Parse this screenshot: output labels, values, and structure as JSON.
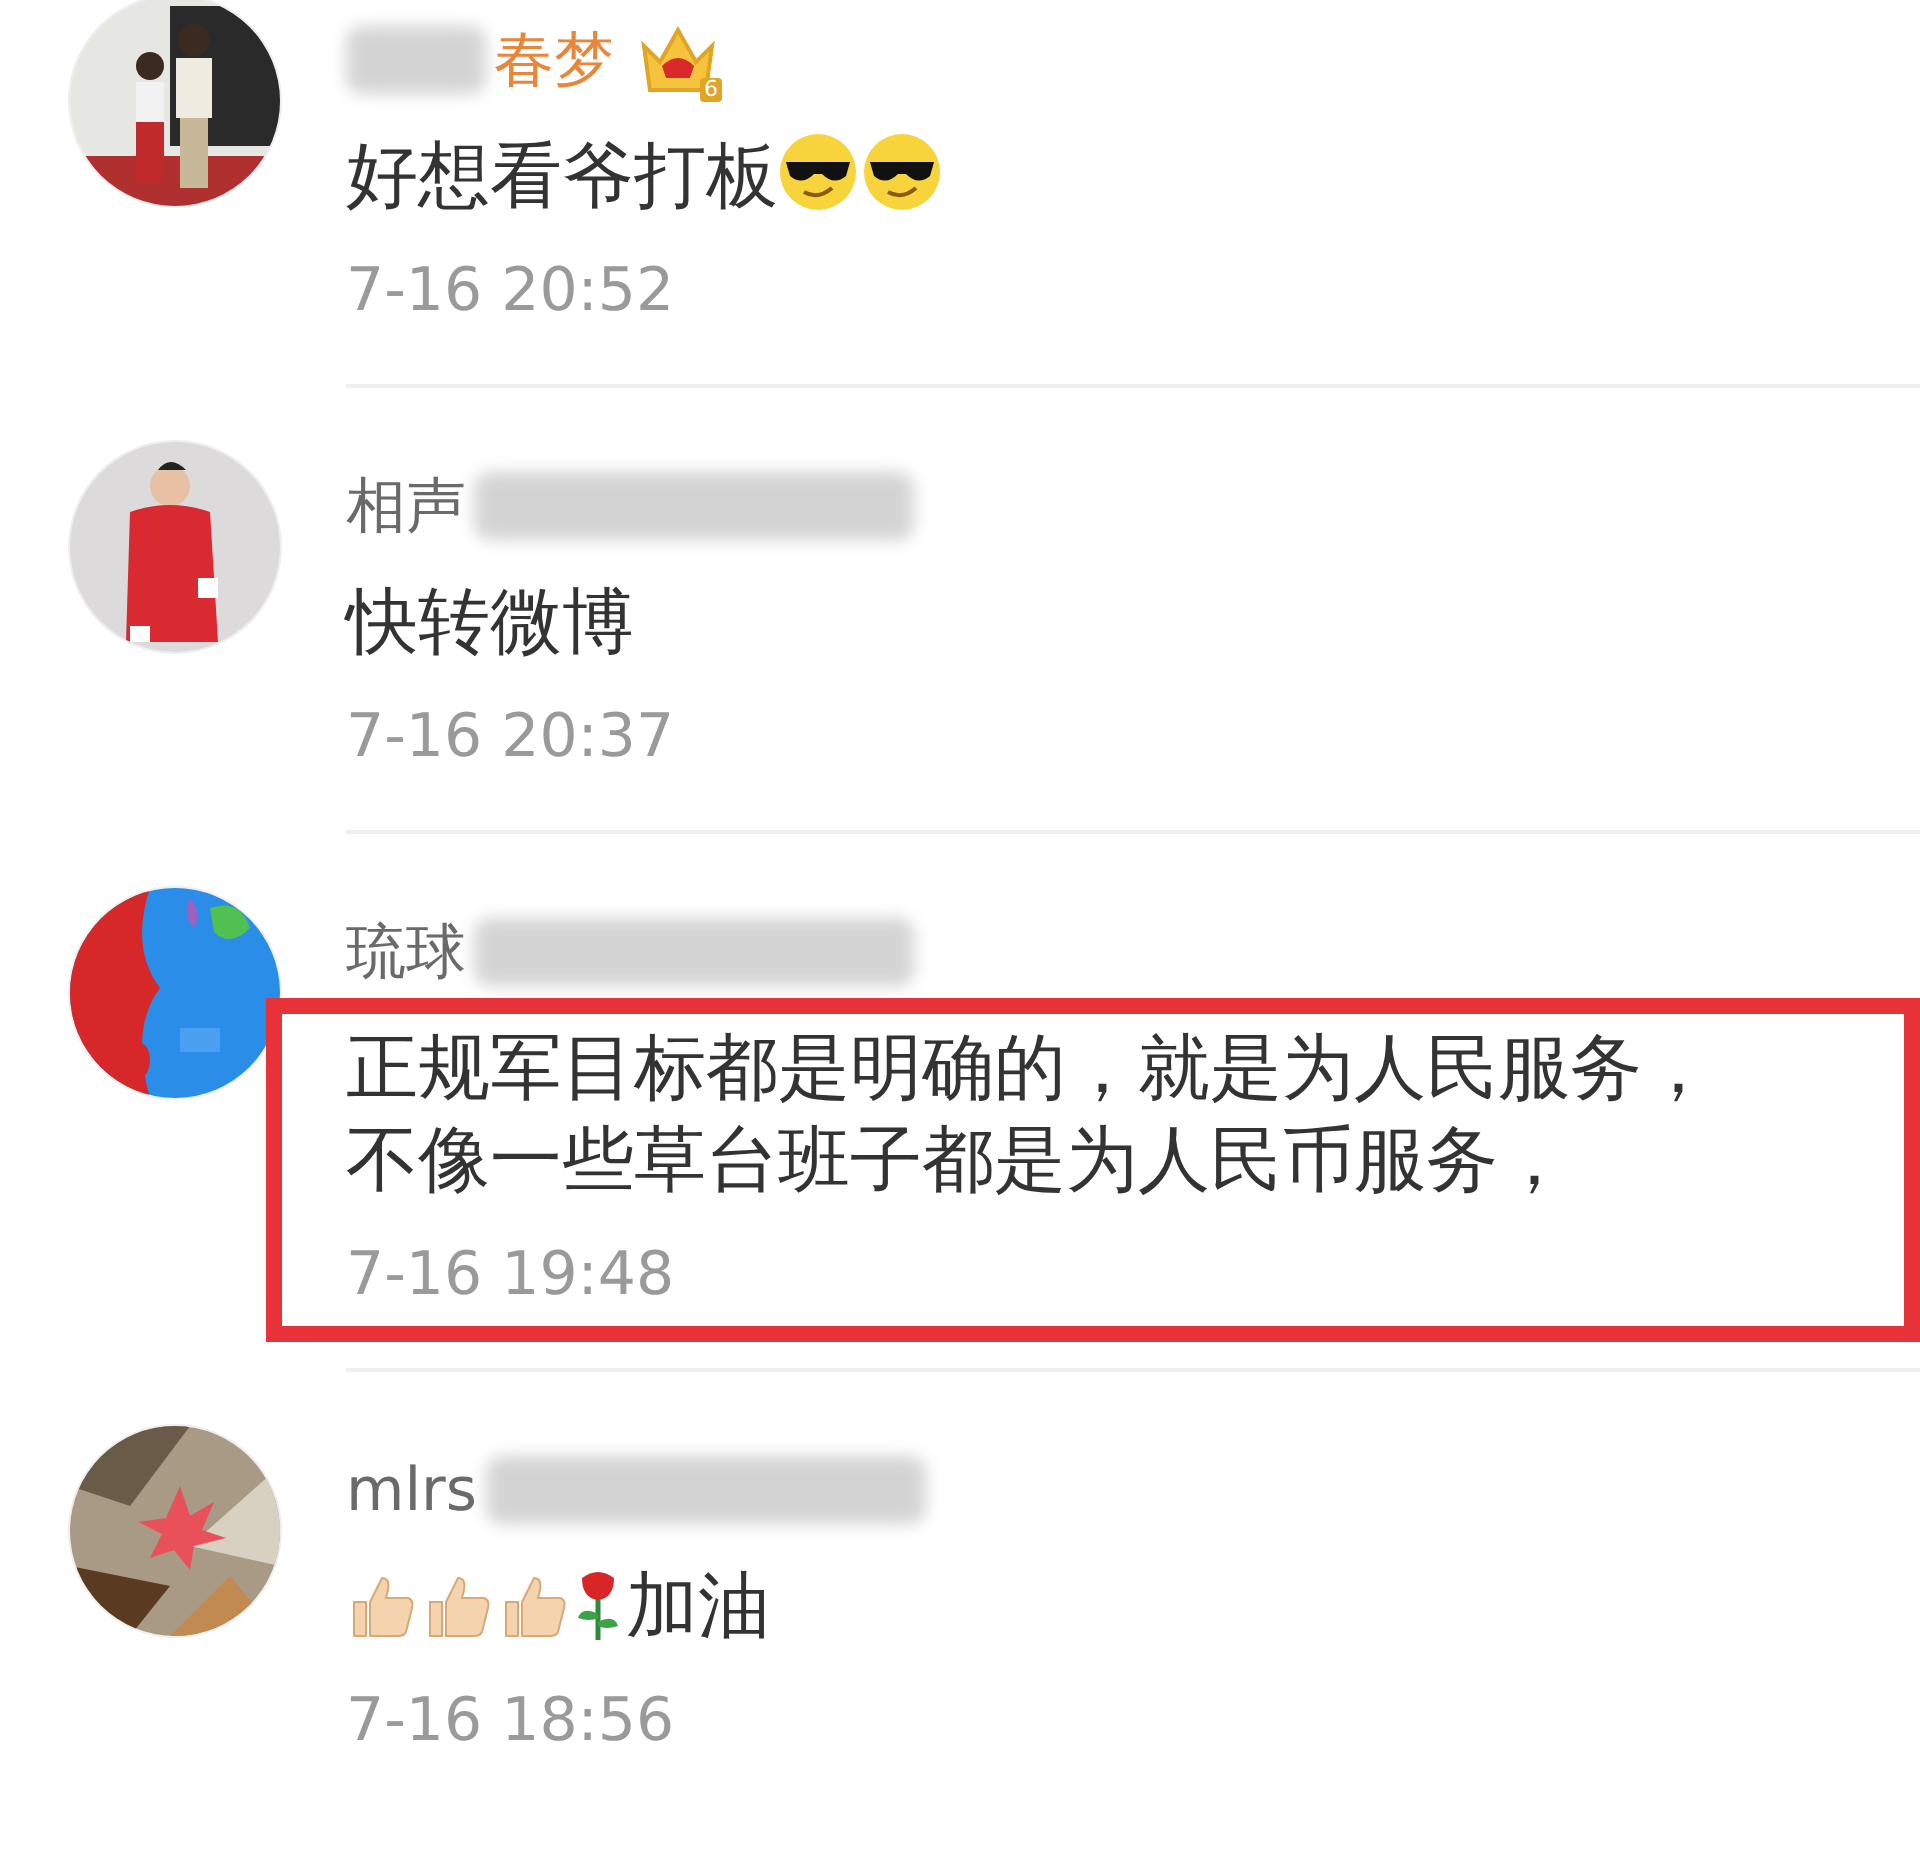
{
  "comments": [
    {
      "name": "春梦",
      "redacted_start": true,
      "redacted_end": false,
      "vip": true,
      "vip_level": "6",
      "text": "好想看爷打板",
      "emoji_after": [
        {
          "kind": "sunglasses"
        },
        {
          "kind": "sunglasses"
        }
      ],
      "time": "7-16 20:52",
      "highlighted": false
    },
    {
      "name": "相声",
      "redacted_start": false,
      "redacted_end": true,
      "vip": false,
      "text": "快转微博",
      "time": "7-16 20:37",
      "highlighted": false
    },
    {
      "name": "琉球",
      "redacted_start": false,
      "redacted_end": true,
      "vip": false,
      "text": "正规军目标都是明确的，就是为人民服务，不像一些草台班子都是为人民币服务，",
      "time": "7-16 19:48",
      "highlighted": true
    },
    {
      "name": "mlrs",
      "redacted_start": false,
      "redacted_end": true,
      "vip": false,
      "text": "加油",
      "emoji_before": [
        {
          "kind": "thumbs-up"
        },
        {
          "kind": "thumbs-up"
        },
        {
          "kind": "thumbs-up"
        },
        {
          "kind": "rose"
        }
      ],
      "time": "7-16 18:56",
      "highlighted": false
    }
  ]
}
